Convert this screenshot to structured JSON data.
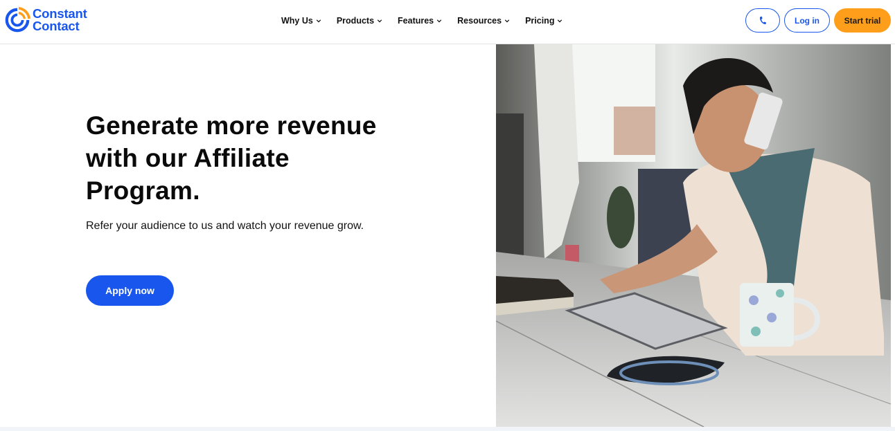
{
  "brand": {
    "name_line1": "Constant",
    "name_line2": "Contact",
    "primary_color": "#1856ed",
    "accent_color": "#ff9e1a"
  },
  "nav": {
    "items": [
      {
        "label": "Why Us",
        "icon": "chevron-down-icon"
      },
      {
        "label": "Products",
        "icon": "chevron-down-icon"
      },
      {
        "label": "Features",
        "icon": "chevron-down-icon"
      },
      {
        "label": "Resources",
        "icon": "chevron-down-icon"
      },
      {
        "label": "Pricing",
        "icon": "chevron-down-icon"
      }
    ]
  },
  "header_actions": {
    "phone_icon": "phone-icon",
    "login_label": "Log in",
    "trial_label": "Start trial"
  },
  "hero": {
    "title": "Generate more revenue with our Affiliate Program.",
    "subtitle": "Refer your audience to us and watch your revenue grow.",
    "cta_label": "Apply now",
    "image_alt": "Woman smiling on phone while using a tablet at a table with a coffee mug"
  }
}
